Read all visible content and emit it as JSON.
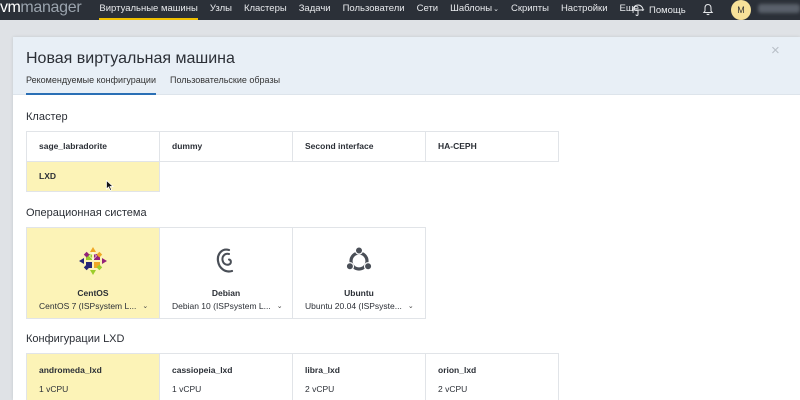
{
  "app": {
    "logo_vm": "vm",
    "logo_manager": "manager"
  },
  "nav": {
    "items": [
      {
        "label": "Виртуальные машины",
        "active": true
      },
      {
        "label": "Узлы"
      },
      {
        "label": "Кластеры"
      },
      {
        "label": "Задачи"
      },
      {
        "label": "Пользователи"
      },
      {
        "label": "Сети"
      },
      {
        "label": "Шаблоны",
        "has_dropdown": true
      },
      {
        "label": "Скрипты"
      },
      {
        "label": "Настройки"
      },
      {
        "label": "Еще",
        "has_dropdown": true
      }
    ],
    "chevron": "⌄",
    "help_label": "Помощь",
    "avatar_initial": "M"
  },
  "panel": {
    "title": "Новая виртуальная машина",
    "close_glyph": "×",
    "tabs": [
      {
        "label": "Рекомендуемые конфигурации",
        "active": true
      },
      {
        "label": "Пользовательские образы"
      }
    ]
  },
  "cluster": {
    "title": "Кластер",
    "items": [
      "sage_labradorite",
      "dummy",
      "Second interface",
      "HA-CEPH",
      "LXD"
    ],
    "selected": "LXD"
  },
  "os": {
    "title": "Операционная система",
    "items": [
      {
        "name": "CentOS",
        "version": "CentOS 7 (ISPsystem L...",
        "icon": "centos-icon",
        "selected": true
      },
      {
        "name": "Debian",
        "version": "Debian 10 (ISPsystem L...",
        "icon": "debian-icon"
      },
      {
        "name": "Ubuntu",
        "version": "Ubuntu 20.04 (ISPsyste...",
        "icon": "ubuntu-icon"
      }
    ],
    "chevron": "⌄"
  },
  "configs": {
    "title": "Конфигурации LXD",
    "items": [
      {
        "name": "andromeda_lxd",
        "cpu": "1 vCPU",
        "selected": true
      },
      {
        "name": "cassiopeia_lxd",
        "cpu": "1 vCPU"
      },
      {
        "name": "libra_lxd",
        "cpu": "2 vCPU"
      },
      {
        "name": "orion_lxd",
        "cpu": "2 vCPU"
      }
    ]
  },
  "colors": {
    "topbar": "#2b3038",
    "accent_yellow": "#f0c000",
    "selected_bg": "#fcf3b7",
    "tab_underline": "#2a6fb5",
    "panel_header": "#e8eff6"
  }
}
